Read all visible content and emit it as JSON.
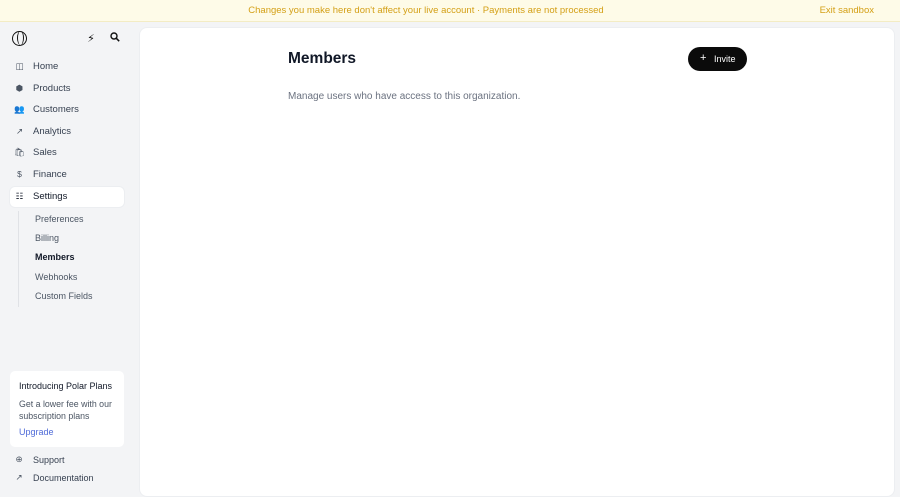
{
  "banner": {
    "message": "Changes you make here don't affect your live account · Payments are not processed",
    "exit_label": "Exit sandbox",
    "color": "#d4a017"
  },
  "sidebar": {
    "top_icons": [
      "bolt-icon",
      "search-icon"
    ],
    "nav": [
      {
        "label": "Home",
        "icon": "home-icon",
        "glyph": "◫"
      },
      {
        "label": "Products",
        "icon": "products-icon",
        "glyph": "⬢"
      },
      {
        "label": "Customers",
        "icon": "customers-icon",
        "glyph": "👥"
      },
      {
        "label": "Analytics",
        "icon": "analytics-icon",
        "glyph": "↗"
      },
      {
        "label": "Sales",
        "icon": "sales-icon",
        "glyph": "🛍"
      },
      {
        "label": "Finance",
        "icon": "finance-icon",
        "glyph": "$"
      },
      {
        "label": "Settings",
        "icon": "settings-icon",
        "glyph": "☷",
        "active": true
      }
    ],
    "settings_subnav": [
      {
        "label": "Preferences"
      },
      {
        "label": "Billing"
      },
      {
        "label": "Members",
        "active": true
      },
      {
        "label": "Webhooks"
      },
      {
        "label": "Custom Fields"
      }
    ],
    "promo": {
      "title": "Introducing Polar Plans",
      "body": "Get a lower fee with our subscription plans",
      "link": "Upgrade"
    },
    "support_label": "Support",
    "docs_label": "Documentation"
  },
  "main": {
    "title": "Members",
    "invite_label": "Invite",
    "description": "Manage users who have access to this organization."
  },
  "colors": {
    "accent_link": "#4f6bd8",
    "button_bg": "#0b0b0b",
    "banner_bg": "#fefbe8"
  }
}
